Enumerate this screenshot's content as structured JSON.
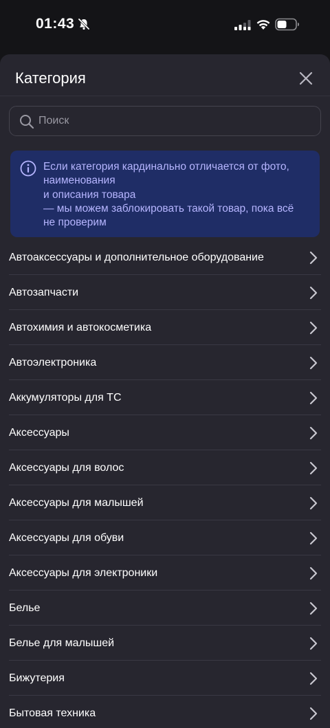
{
  "status_bar": {
    "time": "01:43",
    "icons": [
      "bell-slash-icon",
      "signal-icon",
      "wifi-icon",
      "battery-icon"
    ]
  },
  "sheet": {
    "title": "Категория",
    "close_icon": "close-icon"
  },
  "search": {
    "placeholder": "Поиск",
    "value": "",
    "icon": "search-icon"
  },
  "info": {
    "icon": "info-icon",
    "lines": [
      "Если категория  кардинально отличается от фото,",
      "наименования",
      "и описания товара",
      "— мы можем заблокировать такой товар, пока всё",
      "не проверим"
    ]
  },
  "categories": [
    {
      "label": "Автоаксессуары и дополнительное оборудование"
    },
    {
      "label": "Автозапчасти"
    },
    {
      "label": "Автохимия и автокосметика"
    },
    {
      "label": "Автоэлектроника"
    },
    {
      "label": "Аккумуляторы для ТС"
    },
    {
      "label": "Аксессуары"
    },
    {
      "label": "Аксессуары для волос"
    },
    {
      "label": "Аксессуары для малышей"
    },
    {
      "label": "Аксессуары для обуви"
    },
    {
      "label": "Аксессуары для электроники"
    },
    {
      "label": "Белье"
    },
    {
      "label": "Белье для малышей"
    },
    {
      "label": "Бижутерия"
    },
    {
      "label": "Бытовая техника"
    }
  ],
  "colors": {
    "background": "#141417",
    "sheet": "#27262f",
    "info_bg": "#1f2d66",
    "info_text": "#b6b5ff",
    "divider": "#3a3944"
  }
}
